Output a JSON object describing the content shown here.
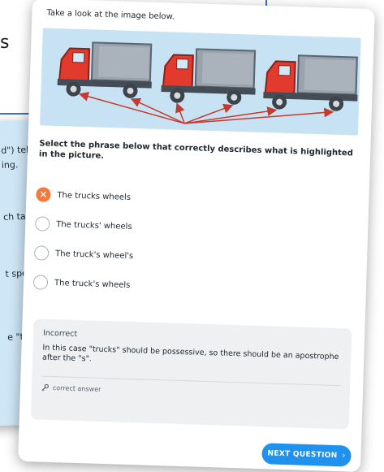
{
  "background": {
    "text_fragment": "s"
  },
  "back_card": {
    "snippets": [
      "d\") tel",
      "ing.",
      "ch ta",
      "t spe",
      "e \"t"
    ]
  },
  "card": {
    "prompt": "Take a look at the image below.",
    "question": "Select the phrase below that correctly describes what is highlighted in the picture.",
    "options": [
      {
        "label": "The trucks wheels",
        "state": "incorrect"
      },
      {
        "label": "The trucks' wheels",
        "state": "unselected"
      },
      {
        "label": "The truck's wheel's",
        "state": "unselected"
      },
      {
        "label": "The truck's wheels",
        "state": "unselected"
      }
    ],
    "feedback": {
      "title": "Incorrect",
      "body": "In this case \"trucks\" should be possessive, so there should be an apostrophe after the \"s\".",
      "link_label": "correct answer",
      "link_icon": "key-icon"
    },
    "next_button": {
      "label": "NEXT QUESTION",
      "icon": "chevron-right-icon"
    }
  },
  "colors": {
    "accent_blue": "#1f91ee",
    "wrong_orange": "#f37a3b",
    "truck_red": "#e23b2e",
    "arrow_red": "#c53a2e"
  }
}
